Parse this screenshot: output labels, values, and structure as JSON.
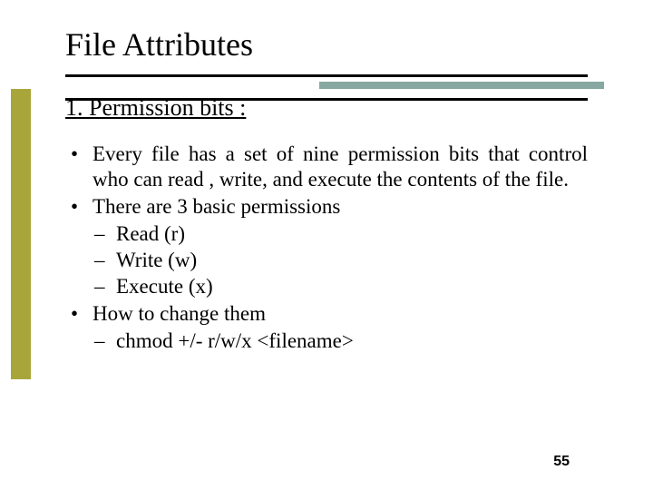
{
  "title": "File Attributes",
  "subtitle": "1. Permission bits :",
  "bullets": {
    "b1": "Every file has a set of nine permission bits that control who can read , write, and execute the contents of the file.",
    "b2": "There are 3 basic permissions",
    "b2_sub": {
      "s1": "Read (r)",
      "s2": "Write (w)",
      "s3": "Execute (x)"
    },
    "b3": "How to change them",
    "b3_sub": {
      "s1": "chmod +/- r/w/x <filename>"
    }
  },
  "page_number": "55"
}
